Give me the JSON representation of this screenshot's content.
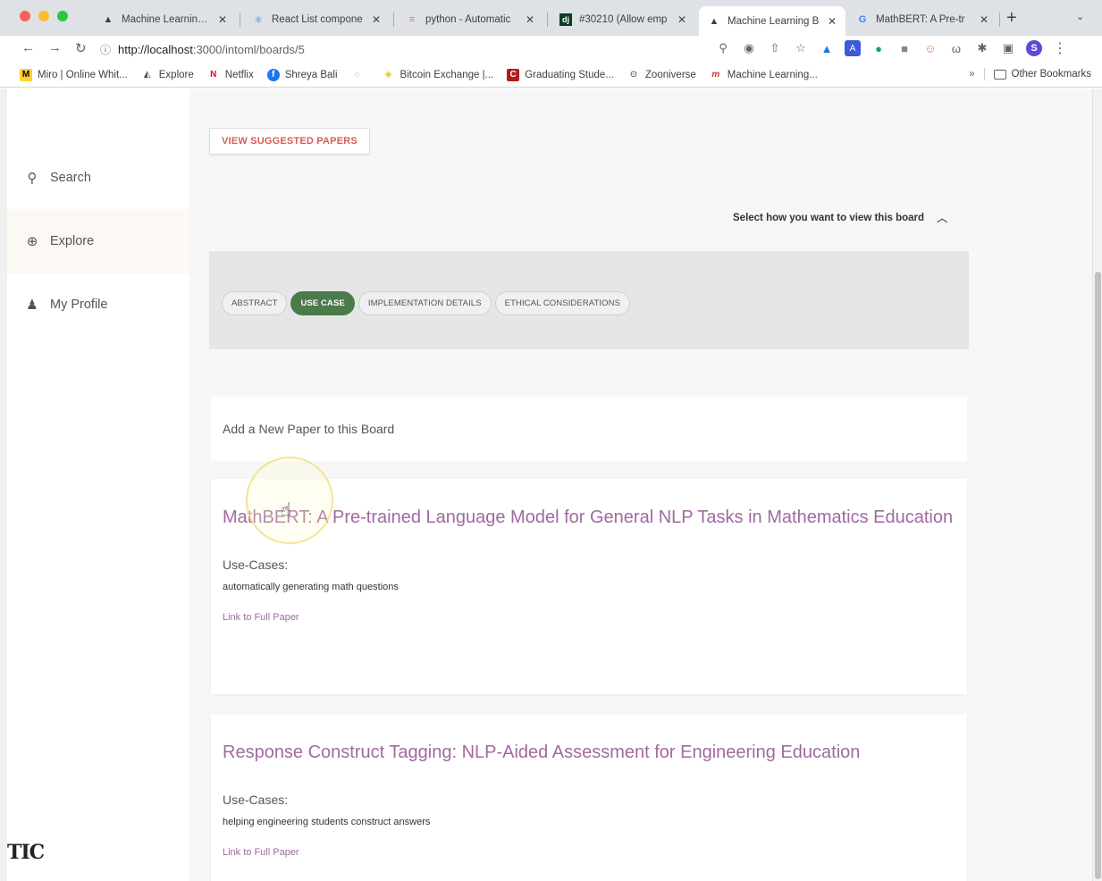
{
  "browser": {
    "tabs": [
      {
        "title": "Machine Learning B",
        "icon": "triangle-icon"
      },
      {
        "title": "React List compone",
        "icon": "react-icon"
      },
      {
        "title": "python - Automatic",
        "icon": "stackoverflow-icon"
      },
      {
        "title": "#30210 (Allow emp",
        "icon": "django-icon"
      },
      {
        "title": "Machine Learning B",
        "icon": "triangle-icon"
      },
      {
        "title": "MathBERT: A Pre-tr",
        "icon": "google-icon"
      }
    ],
    "url_host": "http://localhost",
    "url_rest": ":3000/intoml/boards/5",
    "profile_initial": "S",
    "bookmarks": [
      {
        "label": "Miro | Online Whit...",
        "icon": "miro-icon"
      },
      {
        "label": "Explore",
        "icon": "explore-icon"
      },
      {
        "label": "Netflix",
        "icon": "netflix-icon"
      },
      {
        "label": "Shreya Bali",
        "icon": "facebook-icon"
      },
      {
        "label": "",
        "icon": "loading-icon"
      },
      {
        "label": "Bitcoin Exchange |...",
        "icon": "binance-icon"
      },
      {
        "label": "Graduating Stude...",
        "icon": "cornell-icon"
      },
      {
        "label": "Zooniverse",
        "icon": "zooniverse-icon"
      },
      {
        "label": "Machine Learning...",
        "icon": "ml-icon"
      }
    ],
    "other_bookmarks": "Other Bookmarks",
    "bookmarks_overflow": "»"
  },
  "sidebar": {
    "items": [
      {
        "label": "Search",
        "icon": "search-icon"
      },
      {
        "label": "Explore",
        "icon": "globe-icon"
      },
      {
        "label": "My Profile",
        "icon": "person-icon"
      }
    ],
    "logo_text": "TIC"
  },
  "main": {
    "suggest_button": "VIEW SUGGESTED PAPERS",
    "view_select_label": "Select how you want to view this board",
    "chips": [
      {
        "label": "ABSTRACT",
        "selected": false
      },
      {
        "label": "USE CASE",
        "selected": true
      },
      {
        "label": "IMPLEMENTATION DETAILS",
        "selected": false
      },
      {
        "label": "ETHICAL CONSIDERATIONS",
        "selected": false
      }
    ],
    "add_paper": "Add a New Paper to this Board",
    "papers": [
      {
        "title": "MathBERT: A Pre-trained Language Model for General NLP Tasks in Mathematics Education",
        "usecase_label": "Use-Cases:",
        "usecase_text": "automatically generating math questions",
        "link": "Link to Full Paper"
      },
      {
        "title": "Response Construct Tagging: NLP-Aided Assessment for Engineering Education",
        "usecase_label": "Use-Cases:",
        "usecase_text": "helping engineering students construct answers",
        "link": "Link to Full Paper"
      }
    ]
  },
  "colors": {
    "accent_green": "#4b7a4b",
    "title_purple": "#a06aa0",
    "suggest_red": "#d1605a"
  }
}
